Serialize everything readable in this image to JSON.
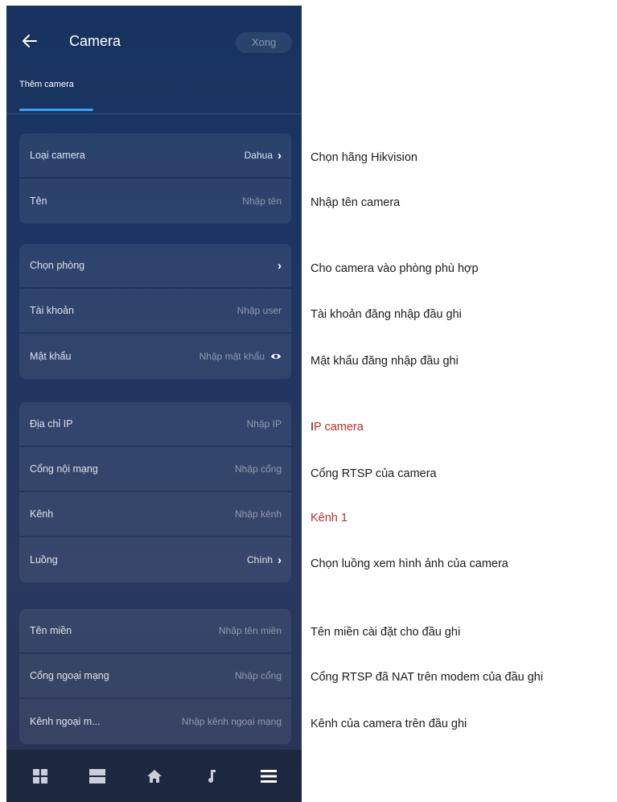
{
  "header": {
    "title": "Camera",
    "done_label": "Xong",
    "tab_label": "Thêm camera"
  },
  "groups": [
    {
      "rows": [
        {
          "label": "Loại camera",
          "value": "Dahua",
          "arrow": true
        },
        {
          "label": "Tên",
          "value": "Nhập tên"
        }
      ]
    },
    {
      "rows": [
        {
          "label": "Chọn phòng",
          "value": "",
          "arrow": true
        },
        {
          "label": "Tài khoản",
          "value": "Nhập user"
        },
        {
          "label": "Mật khẩu",
          "value": "Nhập mật khẩu",
          "eye": true
        }
      ]
    },
    {
      "rows": [
        {
          "label": "Địa chỉ IP",
          "value": "Nhập IP"
        },
        {
          "label": "Cổng nội mạng",
          "value": "Nhập cổng"
        },
        {
          "label": "Kênh",
          "value": "Nhập kênh"
        },
        {
          "label": "Luồng",
          "value": "Chính",
          "arrow": true
        }
      ]
    },
    {
      "rows": [
        {
          "label": "Tên miền",
          "value": "Nhập tên miền"
        },
        {
          "label": "Cổng ngoại mạng",
          "value": "Nhập cổng"
        },
        {
          "label": "Kênh ngoại m...",
          "value": "Nhập kênh ngoại mạng"
        }
      ]
    }
  ],
  "bottom_nav": [
    "grid-icon",
    "list-icon",
    "home-icon",
    "music-icon",
    "menu-icon"
  ],
  "notes": {
    "camera_type": "Chọn hãng Hikvision",
    "name": "Nhập tên camera",
    "room": "Cho camera vào phòng phù hợp",
    "account": "Tài khoản đăng nhập đầu ghi",
    "password": "Mật khẩu đăng nhập đầu ghi",
    "ip_prefix": "I",
    "ip_rest": "P camera",
    "port": "Cổng RTSP của camera",
    "channel": "Kênh 1",
    "stream": "Chọn luồng xem hình ảnh của camera",
    "domain": "Tên miền cài đặt cho đầu ghi",
    "ext_port": "Cổng RTSP đã NAT trên modem của đầu ghi",
    "ext_channel": "Kênh của camera trên đầu ghi"
  },
  "colors": {
    "accent": "#2ea3ff",
    "note_red": "#c22a2a",
    "panel": "#1e3563"
  }
}
